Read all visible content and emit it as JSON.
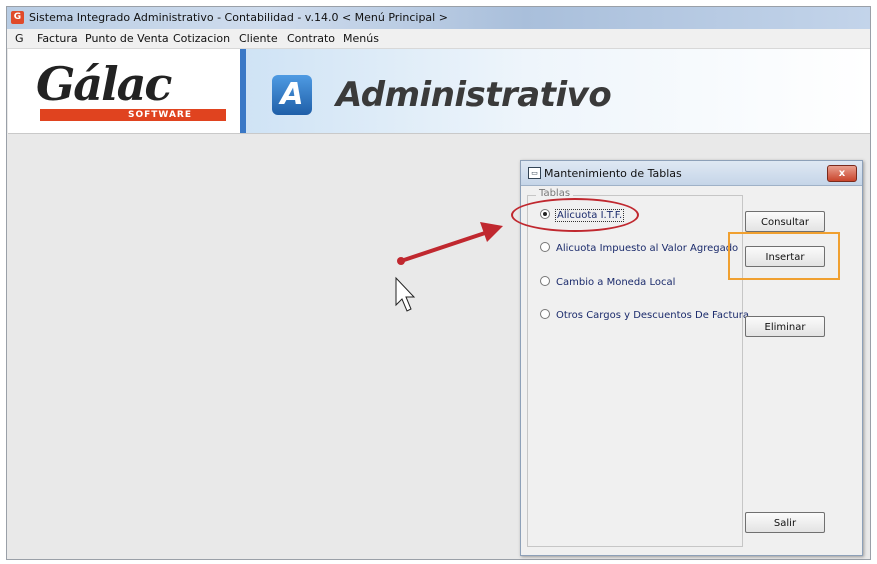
{
  "window": {
    "title": "Sistema Integrado Administrativo - Contabilidad - v.14.0 < Menú Principal >",
    "icon": "app-logo-icon"
  },
  "menubar": {
    "items": [
      {
        "label": "G"
      },
      {
        "label": "Factura"
      },
      {
        "label": "Punto de Venta"
      },
      {
        "label": "Cotizacion"
      },
      {
        "label": "Cliente"
      },
      {
        "label": "Contrato"
      },
      {
        "label": "Menús"
      }
    ]
  },
  "banner": {
    "logo_word": "Gálac",
    "logo_sub": "SOFTWARE",
    "product_letter": "A",
    "product_name": "Administrativo"
  },
  "dialog": {
    "title": "Mantenimiento de Tablas",
    "close_label": "x",
    "group_label": "Tablas",
    "options": [
      {
        "label": "Alicuota I.T.F.",
        "checked": true
      },
      {
        "label": "Alicuota Impuesto al Valor Agregado",
        "checked": false
      },
      {
        "label": "Cambio a Moneda Local",
        "checked": false
      },
      {
        "label": "Otros Cargos y Descuentos De Factura",
        "checked": false
      }
    ],
    "buttons": {
      "consultar": "Consultar",
      "insertar": "Insertar",
      "eliminar": "Eliminar",
      "salir": "Salir"
    }
  },
  "colors": {
    "highlight_ellipse": "#c0282f",
    "highlight_box": "#f0a030",
    "arrow": "#c0282f"
  }
}
